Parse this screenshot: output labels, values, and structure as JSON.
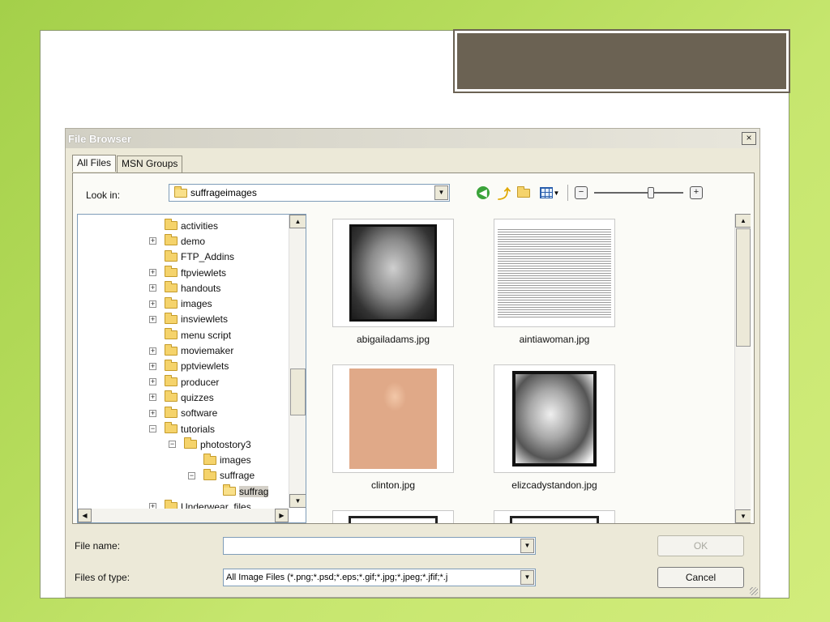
{
  "dialog": {
    "title": "File Browser",
    "close_glyph": "×"
  },
  "tabs": [
    {
      "label": "All Files",
      "active": true
    },
    {
      "label": "MSN Groups",
      "active": false
    }
  ],
  "look_in": {
    "label": "Look in:",
    "value": "suffrageimages"
  },
  "toolbar": {
    "icons": [
      "back-icon",
      "up-folder-icon",
      "new-folder-icon",
      "views-icon"
    ],
    "zoom_minus": "−",
    "zoom_plus": "+",
    "zoom_level": 0.65
  },
  "tree": {
    "items": [
      {
        "label": "activities",
        "expander": "none",
        "indent": 0
      },
      {
        "label": "demo",
        "expander": "+",
        "indent": 0
      },
      {
        "label": "FTP_Addins",
        "expander": "none",
        "indent": 0
      },
      {
        "label": "ftpviewlets",
        "expander": "+",
        "indent": 0
      },
      {
        "label": "handouts",
        "expander": "+",
        "indent": 0
      },
      {
        "label": "images",
        "expander": "+",
        "indent": 0
      },
      {
        "label": "insviewlets",
        "expander": "+",
        "indent": 0
      },
      {
        "label": "menu script",
        "expander": "none",
        "indent": 0
      },
      {
        "label": "moviemaker",
        "expander": "+",
        "indent": 0
      },
      {
        "label": "pptviewlets",
        "expander": "+",
        "indent": 0
      },
      {
        "label": "producer",
        "expander": "+",
        "indent": 0
      },
      {
        "label": "quizzes",
        "expander": "+",
        "indent": 0
      },
      {
        "label": "software",
        "expander": "+",
        "indent": 0
      },
      {
        "label": "tutorials",
        "expander": "−",
        "indent": 0
      },
      {
        "label": "photostory3",
        "expander": "−",
        "indent": 1
      },
      {
        "label": "images",
        "expander": "none",
        "indent": 2
      },
      {
        "label": "suffrage",
        "expander": "−",
        "indent": 2
      },
      {
        "label": "suffrag",
        "expander": "none",
        "indent": 3,
        "selected": true
      },
      {
        "label": "Underwear_files",
        "expander": "+",
        "indent": 0
      }
    ]
  },
  "files": [
    {
      "name": "abigailadams.jpg",
      "kind": "portrait-bw"
    },
    {
      "name": "aintiawoman.jpg",
      "kind": "document"
    },
    {
      "name": "clinton.jpg",
      "kind": "portrait-color"
    },
    {
      "name": "elizcadystandon.jpg",
      "kind": "portrait-bw2"
    }
  ],
  "bottom": {
    "file_name_label": "File name:",
    "file_name_value": "",
    "file_type_label": "Files of type:",
    "file_type_value": "All Image Files (*.png;*.psd;*.eps;*.gif;*.jpg;*.jpeg;*.jfif;*.j",
    "ok_label": "OK",
    "cancel_label": "Cancel"
  }
}
